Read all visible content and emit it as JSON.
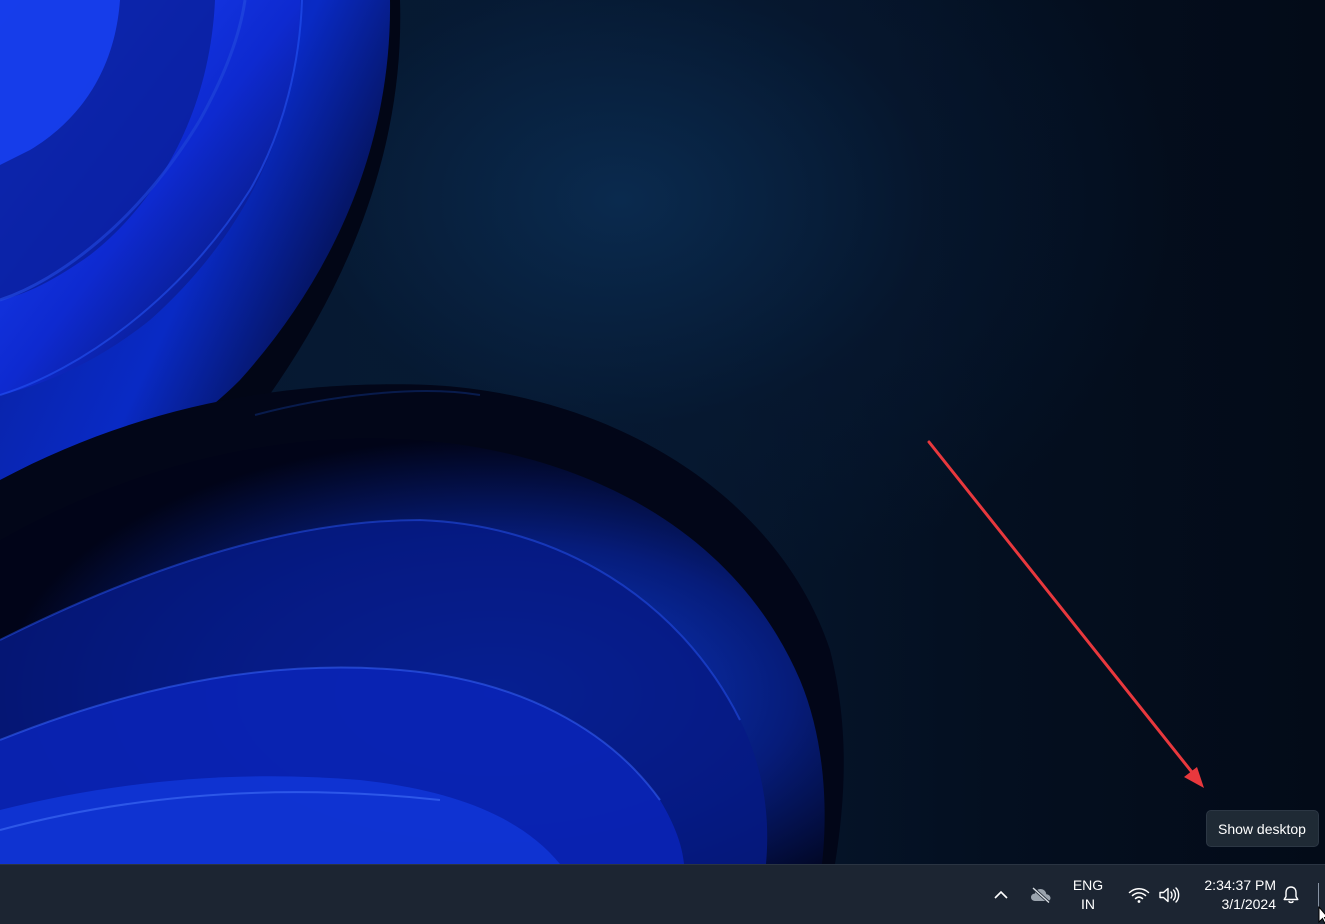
{
  "tooltip": {
    "text": "Show desktop"
  },
  "tray": {
    "chevron_icon": "chevron-up-icon",
    "onedrive_icon": "cloud-offline-icon",
    "language": {
      "line1": "ENG",
      "line2": "IN"
    },
    "wifi_icon": "wifi-icon",
    "volume_icon": "volume-icon",
    "notification_icon": "bell-icon"
  },
  "clock": {
    "time": "2:34:37 PM",
    "date": "3/1/2024"
  },
  "colors": {
    "taskbar": "#1c2532",
    "tooltip_bg": "#1f2a35",
    "annotation_arrow": "#e8383d",
    "wallpaper_accent": "#1a3dff"
  }
}
